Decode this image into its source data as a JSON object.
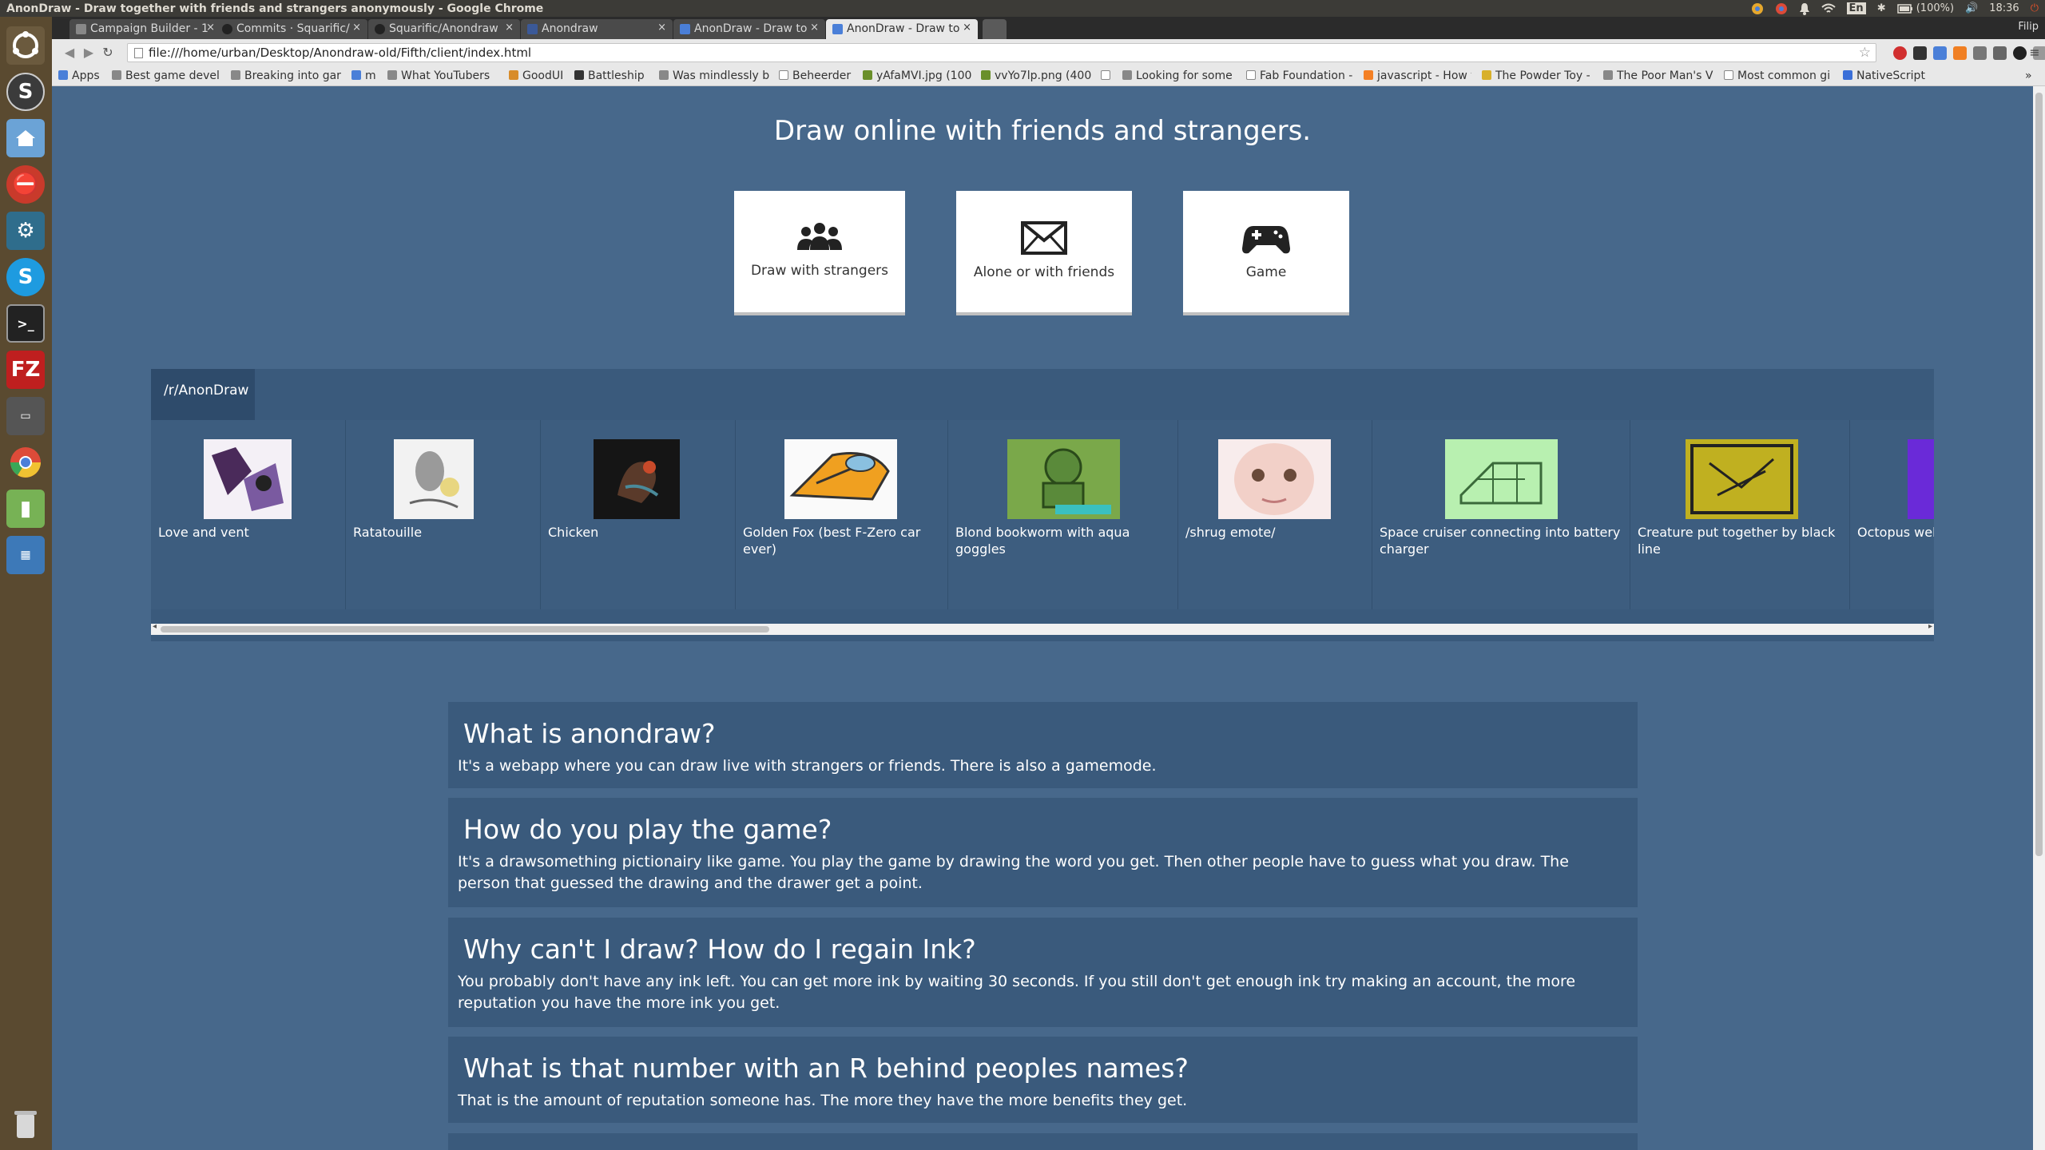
{
  "os_panel": {
    "title": "AnonDraw - Draw together with friends and strangers anonymously - Google Chrome",
    "keyboard": "En",
    "battery": "(100%)",
    "time": "18:36"
  },
  "browser": {
    "profile": "Filip",
    "tabs": [
      {
        "label": "Campaign Builder - 1",
        "active": false
      },
      {
        "label": "Commits · Squarific/",
        "active": false
      },
      {
        "label": "Squarific/Anondraw",
        "active": false
      },
      {
        "label": "Anondraw",
        "active": false
      },
      {
        "label": "AnonDraw - Draw to",
        "active": false
      },
      {
        "label": "AnonDraw - Draw to",
        "active": true
      }
    ],
    "url": "file:///home/urban/Desktop/Anondraw-old/Fifth/client/index.html",
    "bookmarks": [
      "Apps",
      "Best game develo",
      "Breaking into gar",
      "m",
      "What YouTubers",
      "GoodUI",
      "Battleship",
      "Was mindlessly b",
      "Beheerder",
      "yAfaMVI.jpg (100",
      "vvYo7lp.png (400",
      "Looking for some",
      "Fab Foundation -",
      "javascript - How t",
      "The Powder Toy -",
      "The Poor Man's V",
      "Most common gi",
      "NativeScript"
    ]
  },
  "page": {
    "hero_title": "Draw online with friends and strangers.",
    "modes": [
      {
        "label": "Draw with strangers",
        "icon": "users-icon"
      },
      {
        "label": "Alone or with friends",
        "icon": "envelope-icon"
      },
      {
        "label": "Game",
        "icon": "gamepad-icon"
      }
    ],
    "reddit": {
      "tab_label": "/r/AnonDraw",
      "posts": [
        {
          "title": "Love and vent"
        },
        {
          "title": "Ratatouille"
        },
        {
          "title": "Chicken"
        },
        {
          "title": "Golden Fox (best F-Zero car ever)"
        },
        {
          "title": "Blond bookworm with aqua goggles"
        },
        {
          "title": "/shrug emote/"
        },
        {
          "title": "Space cruiser connecting into battery charger"
        },
        {
          "title": "Creature put together by black line"
        },
        {
          "title": "Octopus web"
        }
      ]
    },
    "faq": [
      {
        "q": "What is anondraw?",
        "a": "It's a webapp where you can draw live with strangers or friends. There is also a gamemode."
      },
      {
        "q": "How do you play the game?",
        "a": "It's a drawsomething pictionairy like game. You play the game by drawing the word you get. Then other people have to guess what you draw. The person that guessed the drawing and the drawer get a point."
      },
      {
        "q": "Why can't I draw? How do I regain Ink?",
        "a": "You probably don't have any ink left. You can get more ink by waiting 30 seconds. If you still don't get enough ink try making an account, the more reputation you have the more ink you get."
      },
      {
        "q": "What is that number with an R behind peoples names?",
        "a": "That is the amount of reputation someone has. The more they have the more benefits they get."
      },
      {
        "q": "",
        "a": ""
      }
    ]
  }
}
